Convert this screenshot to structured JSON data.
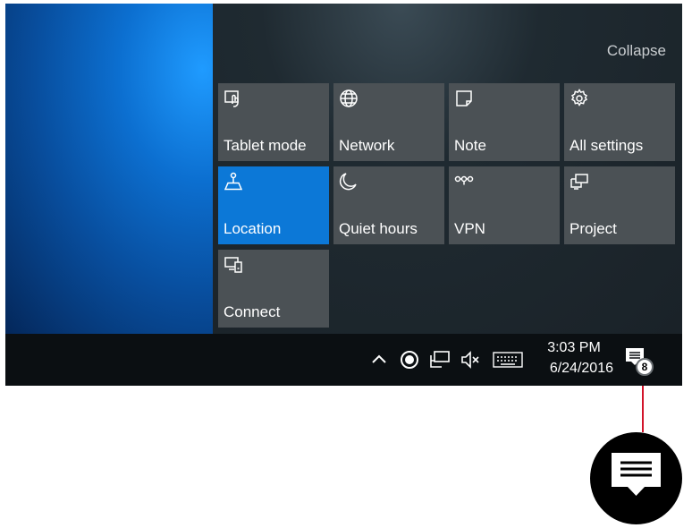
{
  "action_center": {
    "collapse_label": "Collapse",
    "tiles": [
      {
        "label": "Tablet mode",
        "icon": "tablet-mode-icon",
        "active": false
      },
      {
        "label": "Network",
        "icon": "globe-icon",
        "active": false
      },
      {
        "label": "Note",
        "icon": "note-icon",
        "active": false
      },
      {
        "label": "All settings",
        "icon": "gear-icon",
        "active": false
      },
      {
        "label": "Location",
        "icon": "location-icon",
        "active": true
      },
      {
        "label": "Quiet hours",
        "icon": "moon-icon",
        "active": false
      },
      {
        "label": "VPN",
        "icon": "vpn-icon",
        "active": false
      },
      {
        "label": "Project",
        "icon": "project-icon",
        "active": false
      },
      {
        "label": "Connect",
        "icon": "connect-icon",
        "active": false
      }
    ]
  },
  "taskbar": {
    "tray_icons": [
      "chevron-up-icon",
      "record-icon",
      "network-monitor-icon",
      "volume-muted-icon",
      "keyboard-icon"
    ],
    "time": "3:03 PM",
    "date": "6/24/2016",
    "notification_count": "8"
  },
  "colors": {
    "accent": "#0c78d7",
    "tile": "#4b5155",
    "taskbar": "#0b0f12",
    "callout_line": "#d2142a"
  }
}
